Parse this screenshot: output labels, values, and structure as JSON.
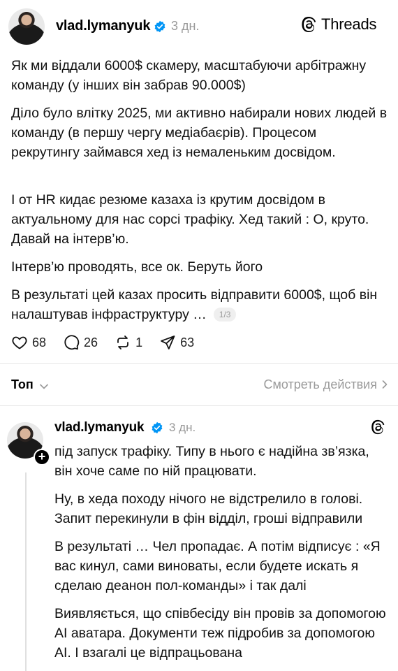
{
  "post": {
    "username": "vlad.lymanyuk",
    "time": "3 дн.",
    "brand": "Threads",
    "paragraphs": [
      "Як ми віддали 6000$ скамеру, масштабуючи арбітражну команду (у інших він забрав 90.000$)",
      "Діло було влітку 2025, ми активно набирали нових людей в команду (в першу чергу медіабаєрів). Процесом рекрутингу займався хед із немаленьким досвідом.",
      "І от HR кидає резюме казаха із крутим досвідом в актуальному для нас сорсі трафіку. Хед такий : О, круто. Давай на інтерв’ю.",
      "Інтерв’ю проводять, все ок. Беруть його",
      "В результаті цей казах просить відправити 6000$, щоб він налаштував інфраструктуру …"
    ],
    "pager": "1/3",
    "likes": "68",
    "comments": "26",
    "reposts": "1",
    "shares": "63"
  },
  "sort": {
    "label": "Топ",
    "view_activity": "Смотреть действия"
  },
  "reply": {
    "username": "vlad.lymanyuk",
    "time": "3 дн.",
    "paragraphs": [
      "під запуск трафіку. Типу в нього є надійна зв’язка, він хоче саме по ній працювати.",
      "Ну, в хеда походу нічого не відстрелило в голові. Запит перекинули в фін відділ, гроші відправили",
      "В результаті … Чел пропадає. А потім відписує : «Я вас кинул, сами виноваты, если будете искать я сделаю деанон пол-команды» і так далі",
      "Виявляється, що співбесіду він провів за допомогою AI аватара. Документи теж підробив за допомогою AI. І взагалі це відпрацьована"
    ]
  },
  "colors": {
    "verified_blue": "#0095f6",
    "muted_text": "#999999"
  },
  "icons": [
    "verified-badge-icon",
    "threads-logo-icon",
    "heart-icon",
    "comment-icon",
    "repost-icon",
    "share-icon",
    "chevron-down-icon",
    "chevron-right-icon",
    "plus-icon"
  ]
}
